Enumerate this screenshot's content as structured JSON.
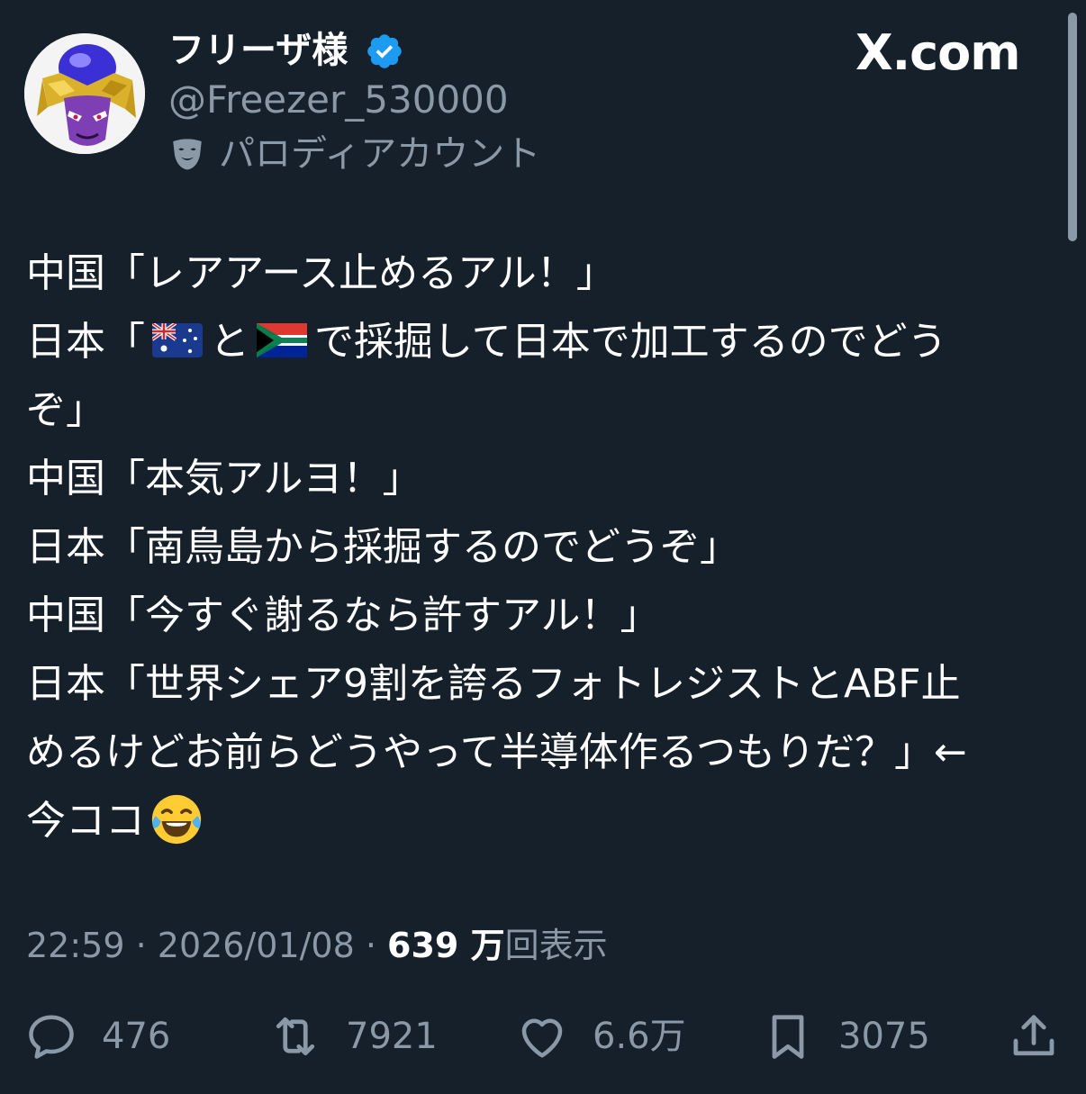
{
  "header": {
    "display_name": "フリーザ様",
    "handle": "@Freezer_530000",
    "parody_label": "パロディアカウント",
    "brand": "X.com",
    "avatar_icon": "frieza-avatar",
    "verified_icon": "verified-badge-icon",
    "parody_icon": "theater-mask-icon"
  },
  "tweet": {
    "lines": {
      "l1": "中国「レアアース止めるアル！」",
      "l2_prefix": "日本「",
      "l2_mid": "と",
      "l2_suffix": "で採掘して日本で加工するのでどう",
      "l3": "ぞ」",
      "l4": "中国「本気アルヨ！」",
      "l5": "日本「南鳥島から採掘するのでどうぞ」",
      "l6": "中国「今すぐ謝るなら許すアル！」",
      "l7": "日本「世界シェア9割を誇るフォトレジストとABF止",
      "l8": "めるけどお前らどうやって半導体作るつもりだ？」←",
      "l9": "今ココ"
    },
    "emojis": [
      "flag-australia",
      "flag-south-africa",
      "face-with-tears-of-joy"
    ]
  },
  "meta": {
    "time": "22:59",
    "separator": " · ",
    "date": "2026/01/08",
    "views_count": "639 万",
    "views_label": "回表示"
  },
  "actions": {
    "reply_count": "476",
    "repost_count": "7921",
    "like_count": "6.6万",
    "bookmark_count": "3075"
  },
  "colors": {
    "background": "#15202b",
    "text": "#ffffff",
    "secondary": "#8b98a5",
    "verified": "#1d9bf0"
  }
}
